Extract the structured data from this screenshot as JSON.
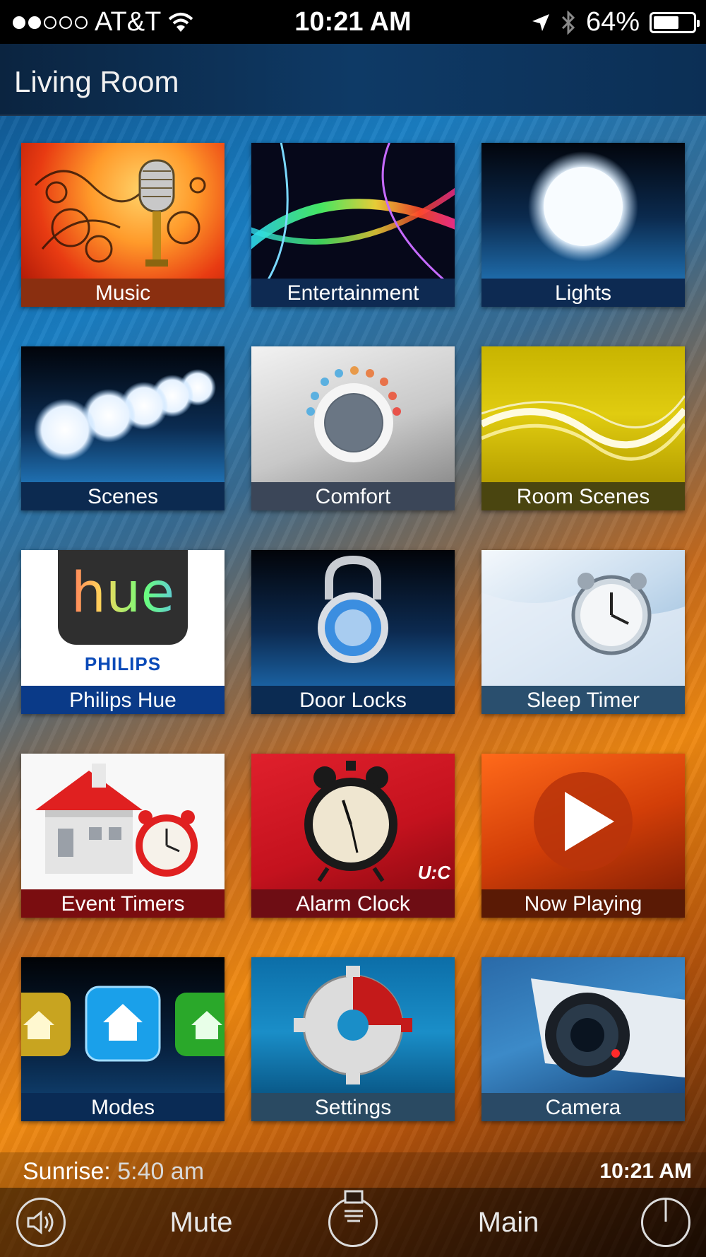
{
  "status_bar": {
    "carrier": "AT&T",
    "time": "10:21 AM",
    "battery": "64%",
    "battery_level": 0.64,
    "signal_bars_filled": 2,
    "signal_bars_total": 5,
    "icons": [
      "signal-dots-icon",
      "wifi-icon",
      "location-arrow-icon",
      "bluetooth-icon",
      "battery-icon"
    ]
  },
  "header": {
    "title": "Living Room"
  },
  "tiles": [
    {
      "label": "Music",
      "label_color": "#8a2f10"
    },
    {
      "label": "Entertainment",
      "label_color": "#0e2a52"
    },
    {
      "label": "Lights",
      "label_color": "#0d2a52"
    },
    {
      "label": "Scenes",
      "label_color": "#0c2a50"
    },
    {
      "label": "Comfort",
      "label_color": "#3b4658"
    },
    {
      "label": "Room Scenes",
      "label_color": "#4a4510"
    },
    {
      "label": "Philips Hue",
      "label_color": "#0a3a88",
      "hue_text": "hue",
      "brand_text": "PHILIPS"
    },
    {
      "label": "Door Locks",
      "label_color": "#0b2b52"
    },
    {
      "label": "Sleep Timer",
      "label_color": "#2a4f6e"
    },
    {
      "label": "Event Timers",
      "label_color": "#7a0d10"
    },
    {
      "label": "Alarm Clock",
      "label_color": "#6e0d14",
      "watermark": "U:C"
    },
    {
      "label": "Now Playing",
      "label_color": "#5a1a05"
    },
    {
      "label": "Modes",
      "label_color": "#0a2b55"
    },
    {
      "label": "Settings",
      "label_color": "#2a4a62"
    },
    {
      "label": "Camera",
      "label_color": "#2a4a66"
    }
  ],
  "info_bar": {
    "sunrise_label": "Sunrise:",
    "sunrise_value": "5:40 am",
    "clock": "10:21 AM"
  },
  "bottom_bar": {
    "volume_icon": "speaker-icon",
    "mute_label": "Mute",
    "menu_icon": "remote-menu-icon",
    "main_label": "Main",
    "power_icon": "power-icon"
  }
}
